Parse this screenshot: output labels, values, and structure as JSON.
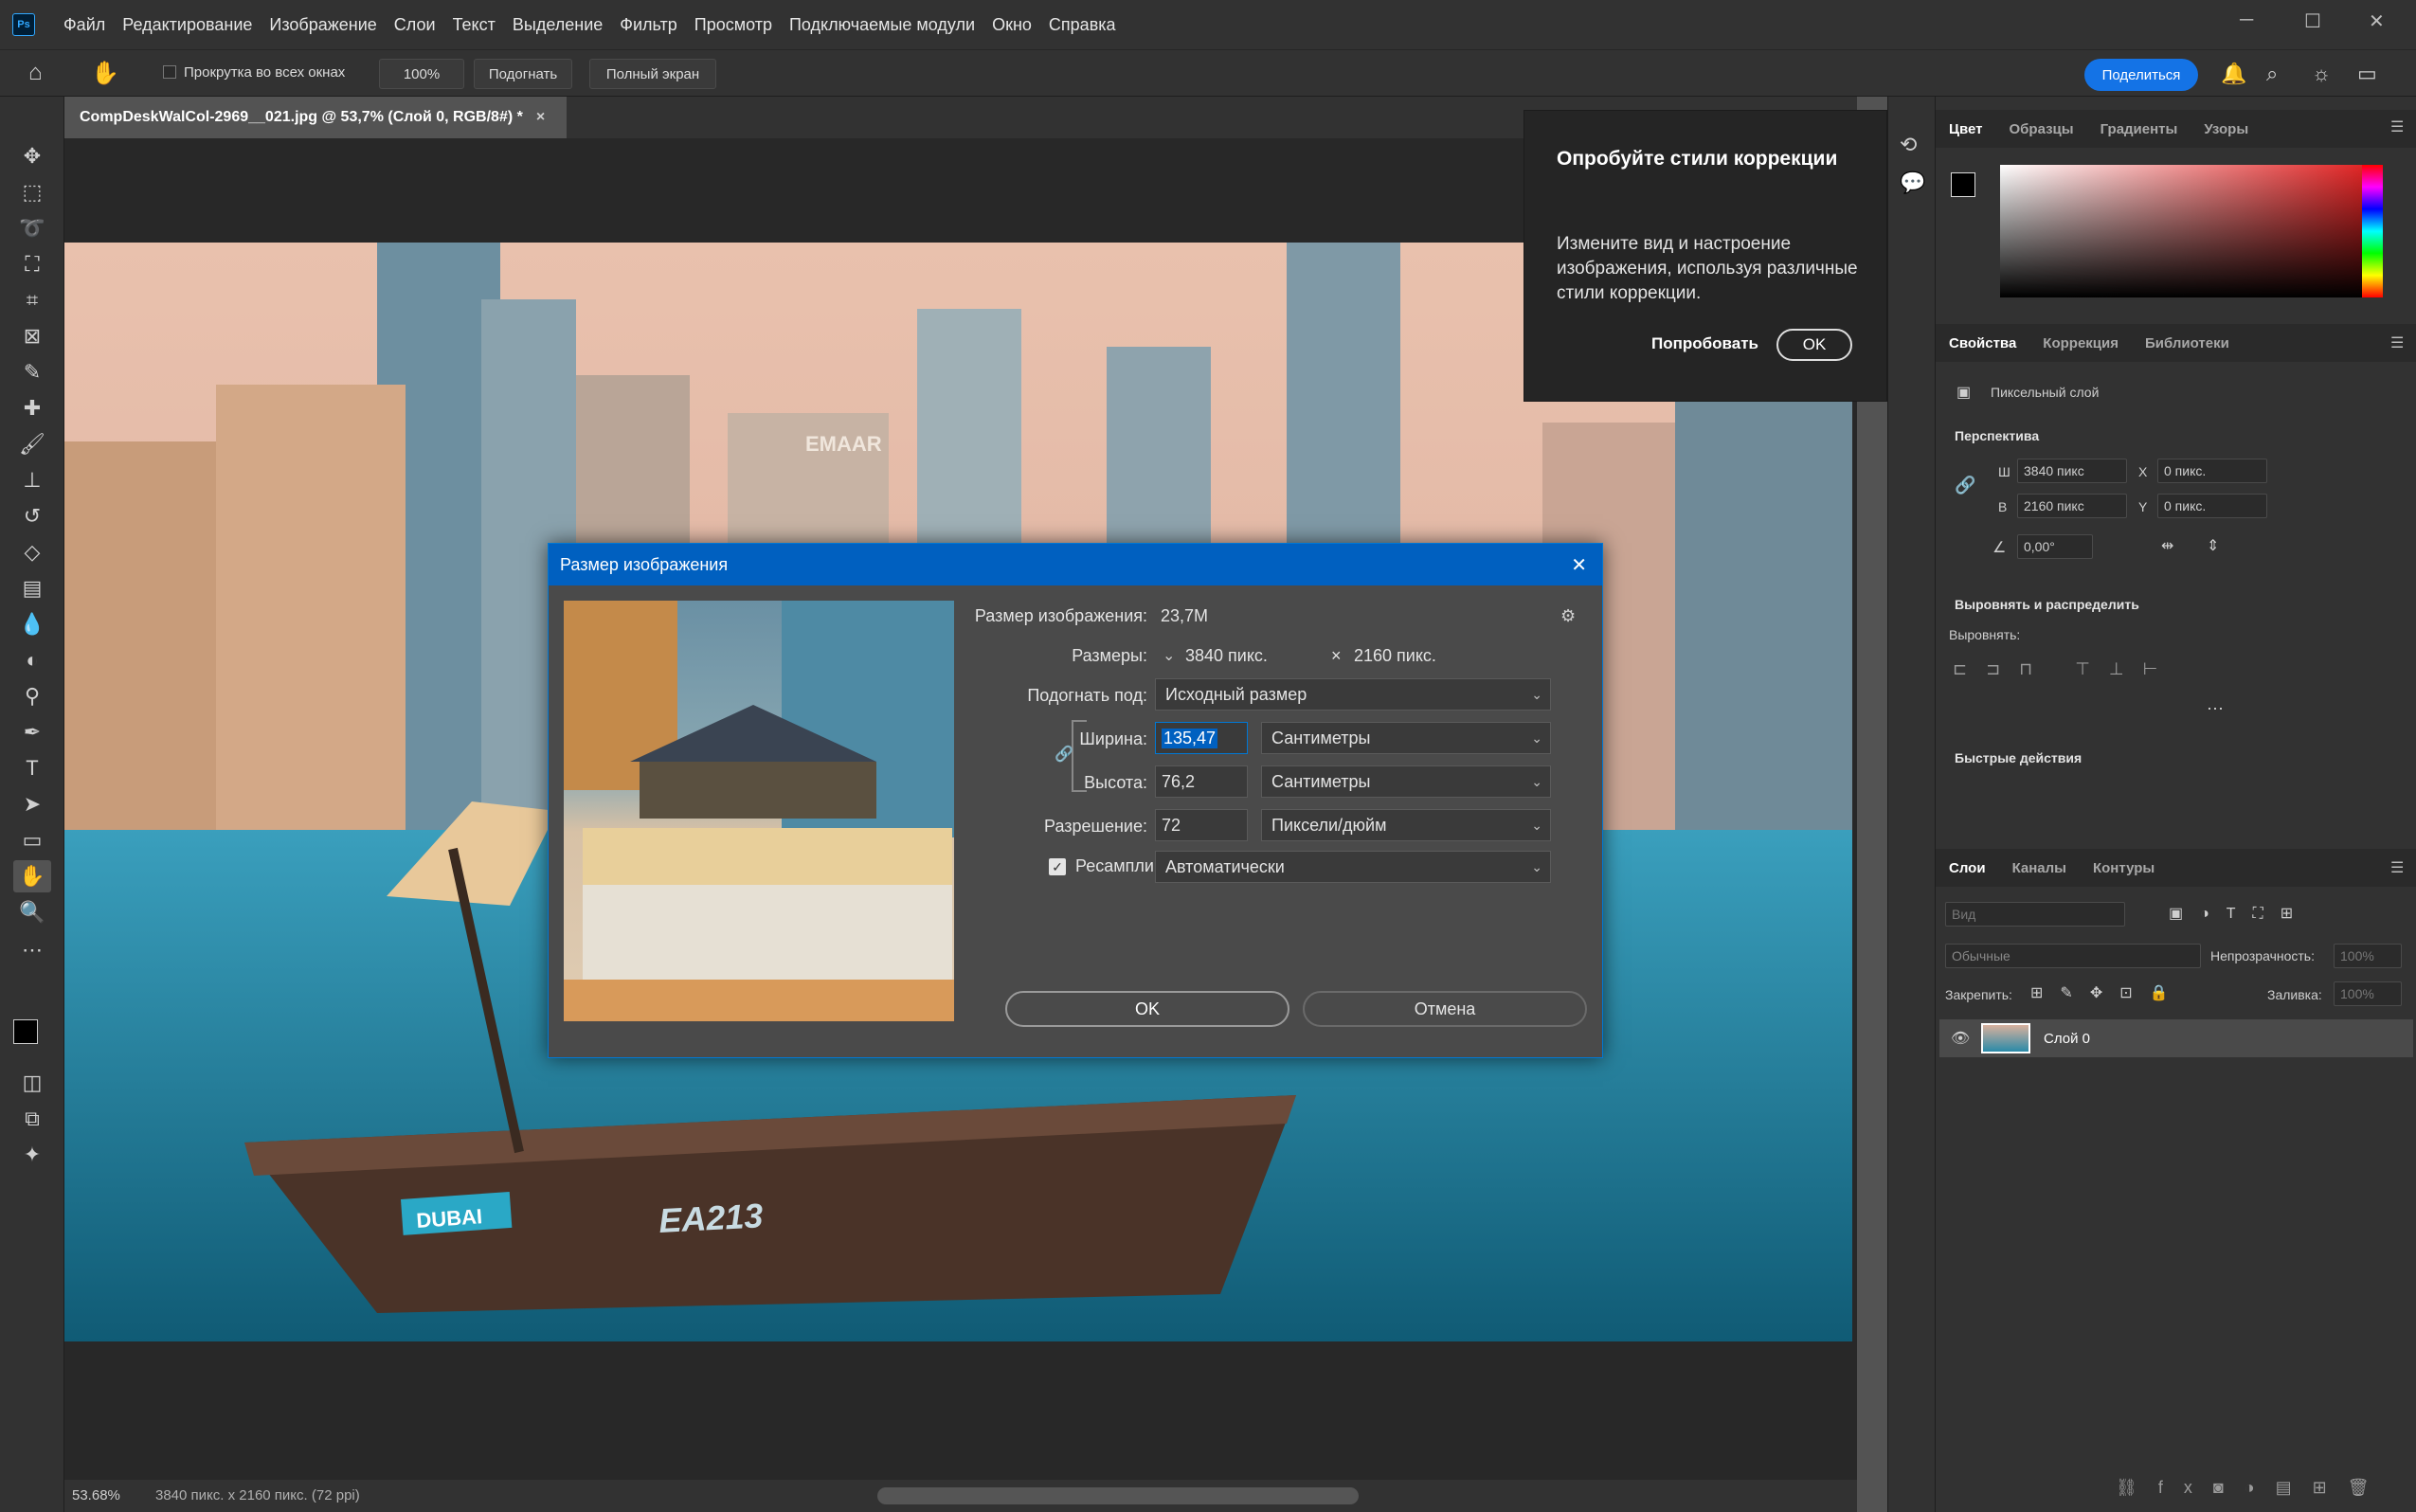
{
  "menubar": {
    "logo": "Ps",
    "items": [
      "Файл",
      "Редактирование",
      "Изображение",
      "Слои",
      "Текст",
      "Выделение",
      "Фильтр",
      "Просмотр",
      "Подключаемые модули",
      "Окно",
      "Справка"
    ]
  },
  "options": {
    "scroll_all": "Прокрутка во всех окнах",
    "zoom": "100%",
    "fit": "Подогнать",
    "fullscreen": "Полный экран",
    "share": "Поделиться"
  },
  "document": {
    "tab_title": "CompDeskWalCol-2969__021.jpg @ 53,7% (Слой 0, RGB/8#) *",
    "close": "×"
  },
  "photo": {
    "sign": "EMAAR",
    "boat_number": "EA213",
    "boat_logo": "DUBAI"
  },
  "status": {
    "zoom": "53.68%",
    "info": "3840 пикс. x 2160 пикс. (72 ppi)"
  },
  "tooltip": {
    "title": "Опробуйте стили коррекции",
    "body": "Измените вид и настроение изображения, используя различные стили коррекции.",
    "try": "Попробовать",
    "ok": "OK"
  },
  "color_panel": {
    "tabs": [
      "Цвет",
      "Образцы",
      "Градиенты",
      "Узоры"
    ]
  },
  "properties": {
    "tabs": [
      "Свойства",
      "Коррекция",
      "Библиотеки"
    ],
    "layer_type": "Пиксельный слой",
    "perspective_title": "Перспектива",
    "w_label": "Ш",
    "w_value": "3840 пикс",
    "h_label": "В",
    "h_value": "2160 пикс",
    "x_label": "X",
    "x_value": "0 пикс.",
    "y_label": "Y",
    "y_value": "0 пикс.",
    "angle": "0,00°",
    "align_title": "Выровнять и распределить",
    "align_label": "Выровнять:",
    "quick_title": "Быстрые действия"
  },
  "layers": {
    "tabs": [
      "Слои",
      "Каналы",
      "Контуры"
    ],
    "search_placeholder": "Вид",
    "blend_mode": "Обычные",
    "opacity_label": "Непрозрачность:",
    "opacity_value": "100%",
    "lock_label": "Закрепить:",
    "fill_label": "Заливка:",
    "fill_value": "100%",
    "layer_name": "Слой 0"
  },
  "dialog": {
    "title": "Размер изображения",
    "size_label": "Размер изображения:",
    "size_value": "23,7M",
    "dims_label": "Размеры:",
    "dims_w": "3840 пикс.",
    "dims_x": "×",
    "dims_h": "2160 пикс.",
    "fit_label": "Подогнать под:",
    "fit_value": "Исходный размер",
    "width_label": "Ширина:",
    "width_value": "135,47",
    "width_unit": "Сантиметры",
    "height_label": "Высота:",
    "height_value": "76,2",
    "height_unit": "Сантиметры",
    "res_label": "Разрешение:",
    "res_value": "72",
    "res_unit": "Пиксели/дюйм",
    "resample_label": "Ресамплинг:",
    "resample_value": "Автоматически",
    "ok": "OK",
    "cancel": "Отмена"
  }
}
